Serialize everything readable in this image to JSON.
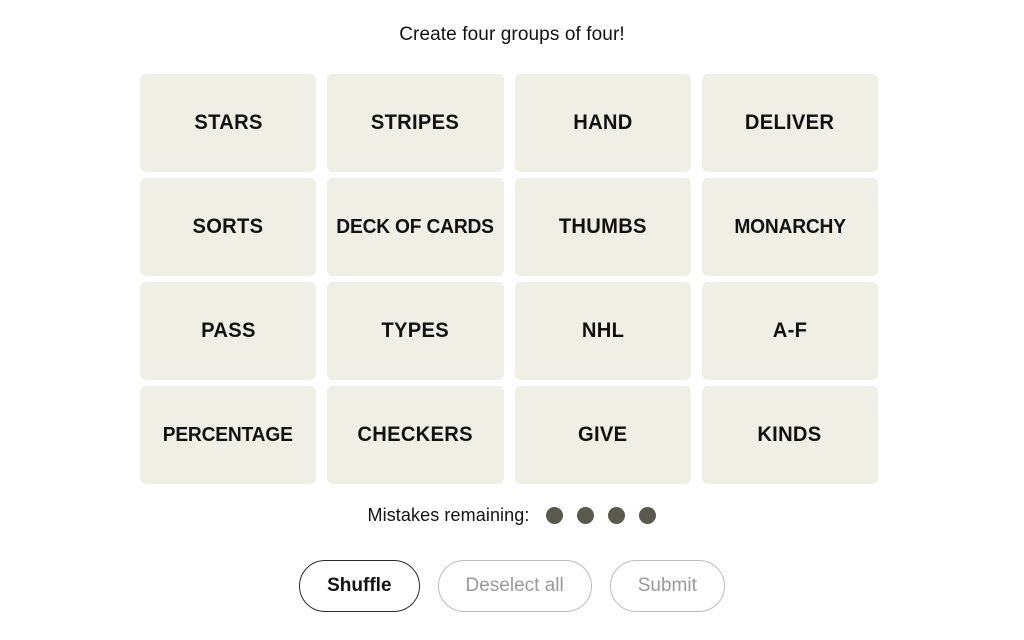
{
  "game": {
    "prompt": "Create four groups of four!",
    "tiles": [
      {
        "label": "STARS"
      },
      {
        "label": "STRIPES"
      },
      {
        "label": "HAND"
      },
      {
        "label": "DELIVER"
      },
      {
        "label": "SORTS"
      },
      {
        "label": "DECK OF CARDS"
      },
      {
        "label": "THUMBS"
      },
      {
        "label": "MONARCHY"
      },
      {
        "label": "PASS"
      },
      {
        "label": "TYPES"
      },
      {
        "label": "NHL"
      },
      {
        "label": "A-F"
      },
      {
        "label": "PERCENTAGE"
      },
      {
        "label": "CHECKERS"
      },
      {
        "label": "GIVE"
      },
      {
        "label": "KINDS"
      }
    ],
    "mistakes": {
      "label": "Mistakes remaining:",
      "remaining": 4,
      "dot_color": "#5a594e"
    },
    "controls": {
      "shuffle_label": "Shuffle",
      "deselect_label": "Deselect all",
      "submit_label": "Submit"
    },
    "colors": {
      "page_background": "#ffffff",
      "tile_background": "#efefe6",
      "text": "#121212",
      "disabled_text": "#9a9a9a",
      "disabled_border": "#bcbcbc"
    }
  }
}
